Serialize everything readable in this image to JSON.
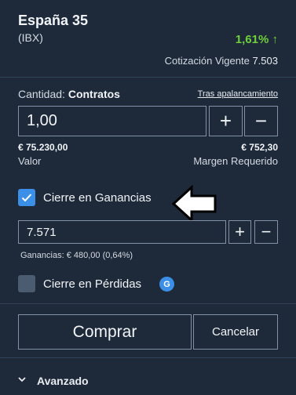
{
  "instrument": {
    "name": "España 35",
    "code": "(IBX)",
    "change": "1,61% ↑",
    "quote_label": "Cotización Vigente",
    "quote_value": "7.503"
  },
  "quantity": {
    "label_prefix": "Cantidad:",
    "label_unit": "Contratos",
    "leverage_link": "Tras apalancamiento",
    "value": "1,00",
    "plus": "+",
    "minus": "−"
  },
  "summary": {
    "value_amount": "€ 75.230,00",
    "value_label": "Valor",
    "margin_amount": "€ 752,30",
    "margin_label": "Margen Requerido"
  },
  "take_profit": {
    "label": "Cierre en Ganancias",
    "checked": true,
    "value": "7.571",
    "plus": "+",
    "minus": "−",
    "gain_text": "Ganancias:  € 480,00  (0,64%)"
  },
  "stop_loss": {
    "label": "Cierre en Pérdidas",
    "checked": false,
    "badge": "G"
  },
  "actions": {
    "buy": "Comprar",
    "cancel": "Cancelar"
  },
  "advanced": {
    "label": "Avanzado"
  },
  "colors": {
    "background": "#1e2a3a",
    "accent_blue": "#3b8fe6",
    "positive_green": "#6fcf3b",
    "border": "#8391a6"
  }
}
